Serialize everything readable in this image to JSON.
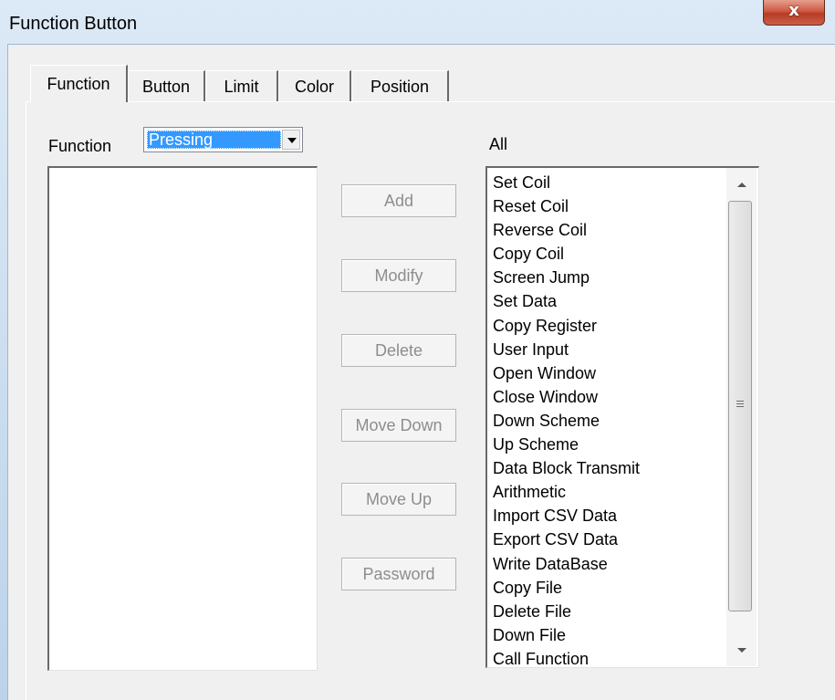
{
  "window": {
    "title": "Function Button",
    "close_glyph": "x",
    "close_icon": "close-x-icon"
  },
  "tabs": [
    {
      "label": "Function",
      "active": true
    },
    {
      "label": "Button",
      "active": false
    },
    {
      "label": "Limit",
      "active": false
    },
    {
      "label": "Color",
      "active": false
    },
    {
      "label": "Position",
      "active": false
    }
  ],
  "function_panel": {
    "function_label": "Function",
    "trigger_select": {
      "value": "Pressing"
    },
    "all_label": "All"
  },
  "buttons": {
    "add": "Add",
    "modify": "Modify",
    "delete": "Delete",
    "move_down": "Move Down",
    "move_up": "Move Up",
    "password": "Password"
  },
  "all_functions": [
    "Set Coil",
    "Reset Coil",
    "Reverse Coil",
    "Copy Coil",
    "Screen Jump",
    "Set Data",
    "Copy Register",
    "User Input",
    "Open Window",
    "Close Window",
    "Down Scheme",
    "Up Scheme",
    "Data Block Transmit",
    "Arithmetic",
    "Import CSV Data",
    "Export CSV Data",
    "Write DataBase",
    "Copy File",
    "Delete File",
    "Down File",
    "Call Function"
  ],
  "colors": {
    "selection": "#3399ff",
    "dialog_bg": "#f0f0f0",
    "close_button": "#c7503a",
    "disabled_text": "#8d8d8d"
  }
}
